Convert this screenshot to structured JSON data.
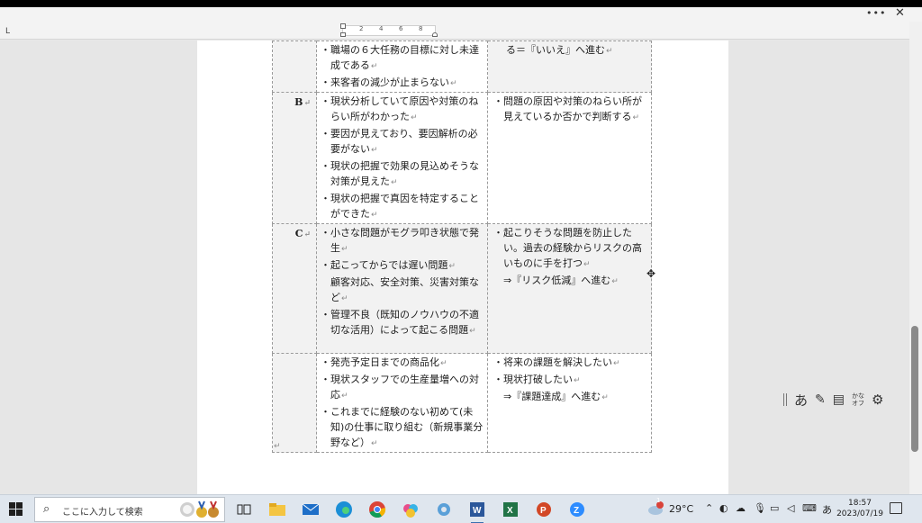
{
  "window": {
    "more_label": "•••",
    "close_label": "✕"
  },
  "ruler": {
    "tab_marker": "L",
    "ticks": [
      "2",
      "4",
      "6",
      "8"
    ]
  },
  "table": {
    "row_top": {
      "mid": [
        "・職場の６大任務の目標に対し未達成である",
        "・来客者の減少が止まらない"
      ],
      "right": [
        "る＝『いいえ』へ進む"
      ]
    },
    "row_b": {
      "label": "B",
      "mid": [
        "・現状分析していて原因や対策のねらい所がわかった",
        "・要因が見えており、要因解析の必要がない",
        "・現状の把握で効果の見込めそうな対策が見えた",
        "・現状の把握で真因を特定することができた"
      ],
      "right": [
        "・問題の原因や対策のねらい所が見えているか否かで判断する"
      ]
    },
    "row_c": {
      "label": "C",
      "mid": [
        "・小さな問題がモグラ叩き状態で発生",
        "・起こってからでは遅い問題",
        "顧客対応、安全対策、災害対策など",
        "・管理不良（既知のノウハウの不適切な活用）によって起こる問題"
      ],
      "right": [
        "・起こりそうな問題を防止したい。過去の経験からリスクの高いものに手を打つ",
        "⇒『リスク低減』へ進む"
      ]
    },
    "row_d": {
      "label": "",
      "mid": [
        "・発売予定日までの商品化",
        "・現状スタッフでの生産量増への対応",
        "・これまでに経験のない初めて(未知)の仕事に取り組む（新規事業分野など）"
      ],
      "right": [
        "・将来の課題を解決したい",
        "・現状打破したい",
        "⇒『課題達成』へ進む"
      ]
    },
    "return_mark": "↵"
  },
  "ime": {
    "mode": "あ",
    "kana_label_top": "かな",
    "kana_label_bottom": "オフ"
  },
  "taskbar": {
    "search_placeholder": "ここに入力して検索",
    "weather_temp": "29°C",
    "weather_badge": "1",
    "ime_mode": "あ",
    "clock_time": "18:57",
    "clock_date": "2023/07/19"
  }
}
